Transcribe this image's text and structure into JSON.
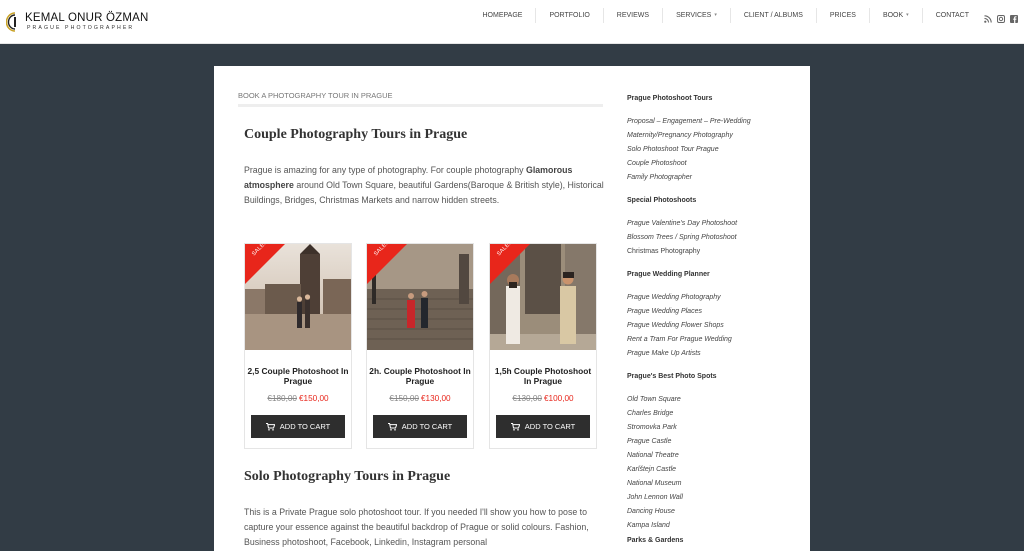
{
  "brand": {
    "name": "KEMAL ONUR ÖZMAN",
    "tagline": "PRAGUE PHOTOGRAPHER"
  },
  "nav": {
    "items": [
      {
        "label": "HOMEPAGE"
      },
      {
        "label": "PORTFOLIO"
      },
      {
        "label": "REVIEWS"
      },
      {
        "label": "SERVICES"
      },
      {
        "label": "CLIENT / ALBUMS"
      },
      {
        "label": "PRICES"
      },
      {
        "label": "BOOK"
      },
      {
        "label": "CONTACT"
      }
    ],
    "social_icons": [
      "rss-icon",
      "instagram-icon",
      "facebook-icon"
    ]
  },
  "main": {
    "breadcrumb": "BOOK A PHOTOGRAPHY TOUR IN PRAGUE",
    "section1_title": "Couple Photography Tours in Prague",
    "section1_text_a": "Prague is amazing for any type of photography. For couple photography ",
    "section1_text_bold": "Glamorous atmosphere",
    "section1_text_b": " around Old Town Square, beautiful Gardens(Baroque & British style), Historical Buildings, Bridges, Christmas Markets and narrow hidden streets.",
    "products": [
      {
        "badge": "SALE!",
        "title": "2,5 Couple Photoshoot In Prague",
        "old_price": "€180,00",
        "new_price": "€150,00",
        "button": "ADD TO CART"
      },
      {
        "badge": "SALE!",
        "title": "2h. Couple Photoshoot In Prague",
        "old_price": "€150,00",
        "new_price": "€130,00",
        "button": "ADD TO CART"
      },
      {
        "badge": "SALE!",
        "title": "1,5h Couple Photoshoot In Prague",
        "old_price": "€130,00",
        "new_price": "€100,00",
        "button": "ADD TO CART"
      }
    ],
    "section2_title": "Solo Photography Tours in Prague",
    "section2_text": "This is a Private Prague solo photoshoot tour. If you needed I'll show you how to pose to capture your essence against the beautiful backdrop of Prague or solid colours. Fashion, Business photoshoot, Facebook, Linkedin, Instagram personal"
  },
  "sidebar": {
    "h1": "Prague Photoshoot Tours",
    "tours": [
      "Proposal – Engagement – Pre-Wedding",
      "Maternity/Pregnancy Photography",
      "Solo Photoshoot Tour Prague",
      "Couple Photoshoot",
      "Family Photographer"
    ],
    "h2": "Special Photoshoots",
    "special": [
      "Prague Valentine's Day Photoshoot",
      "Blossom Trees / Spring Photoshoot",
      "Christmas Photography"
    ],
    "h3": "Prague Wedding Planner",
    "wedding": [
      "Prague Wedding Photography",
      "Prague Wedding Places",
      "Prague Wedding Flower Shops",
      "Rent a Tram For Prague Wedding",
      "Prague Make Up Artists"
    ],
    "h4": "Prague's Best Photo Spots",
    "spots": [
      "Old Town Square",
      "Charles Bridge",
      "Stromovka Park",
      "Prague Castle",
      "National Theatre",
      "Karlštejn Castle",
      "National Museum",
      "John Lennon Wall",
      "Dancing House",
      "Kampa Island"
    ],
    "h5": "Parks & Gardens"
  }
}
